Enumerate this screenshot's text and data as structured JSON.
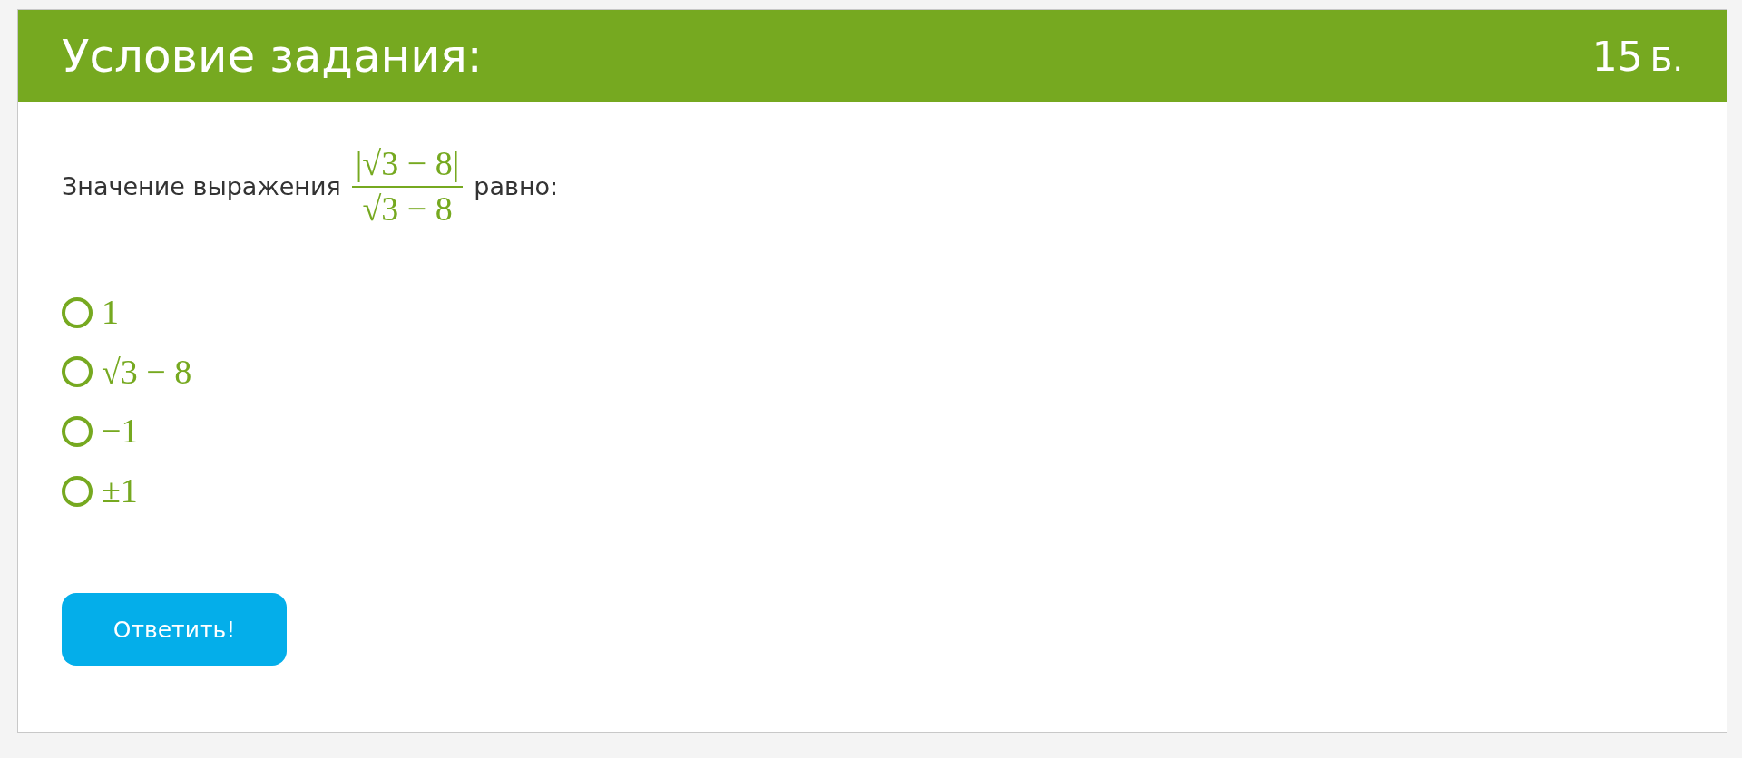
{
  "header": {
    "title": "Условие задания:",
    "score": "15",
    "unit": "Б."
  },
  "question": {
    "before": "Значение выражения",
    "fraction": {
      "numerator": "|√3 − 8|",
      "denominator": "√3 − 8"
    },
    "after": "равно:"
  },
  "options": [
    {
      "label": "1",
      "selected": false
    },
    {
      "label": "√3 − 8",
      "selected": false
    },
    {
      "label": "−1",
      "selected": false
    },
    {
      "label": "±1",
      "selected": false
    }
  ],
  "submit": {
    "label": "Ответить!"
  }
}
